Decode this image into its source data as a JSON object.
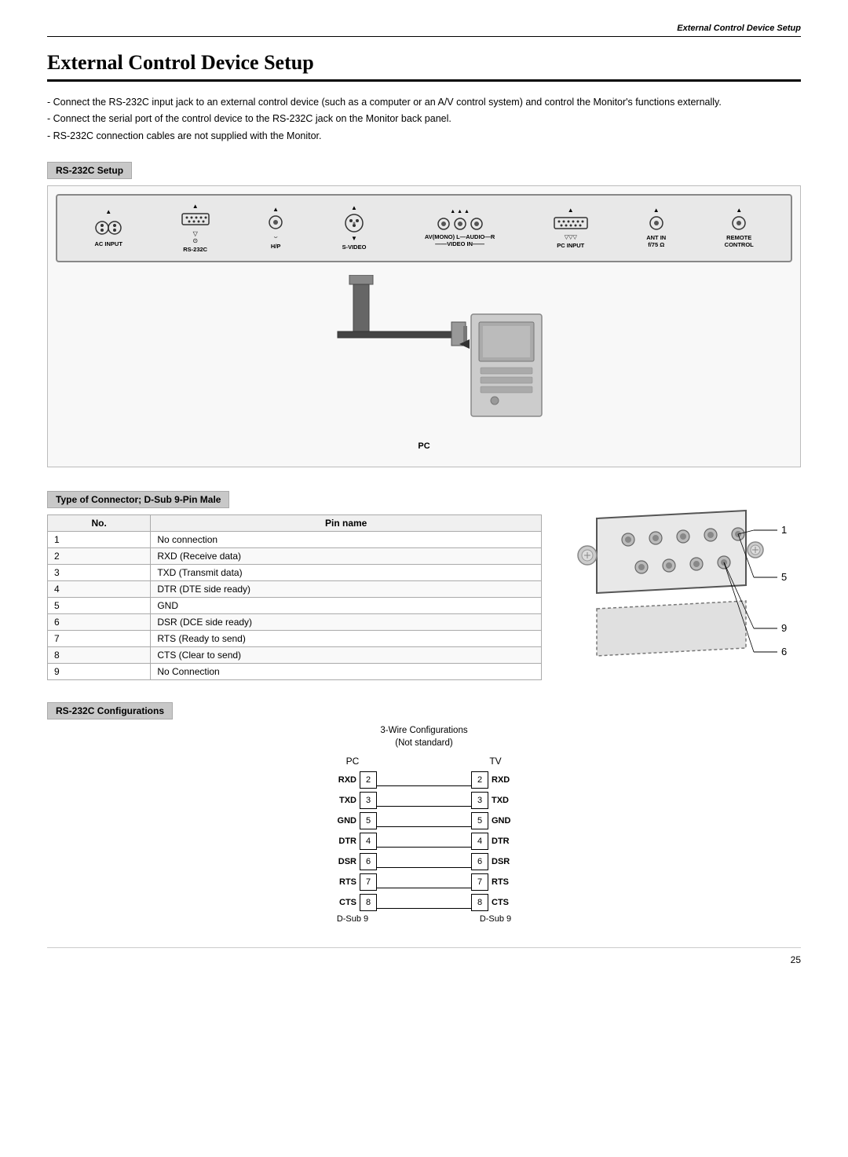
{
  "header": {
    "title": "External Control Device Setup"
  },
  "page_title": "External Control Device Setup",
  "intro": {
    "items": [
      "Connect the RS-232C input jack to an external control device (such as a computer or an A/V control system) and control the Monitor's functions externally.",
      "Connect the serial port of the control device to the RS-232C jack on the Monitor back panel.",
      "RS-232C connection cables are not supplied with the Monitor."
    ]
  },
  "rs232c_setup": {
    "label": "RS-232C Setup",
    "pc_label": "PC",
    "back_panel": {
      "items": [
        {
          "icon": "⊕",
          "label": "AC INPUT"
        },
        {
          "icon": "▭",
          "label": "RS-232C"
        },
        {
          "icon": "●",
          "label": "H/P"
        },
        {
          "icon": "⊕",
          "label": "S-VIDEO"
        },
        {
          "icon": "⊕⊕⊕",
          "label": "AV(MONO)  AUDIO  R\n—VIDEO IN—"
        },
        {
          "icon": "▭▭",
          "label": "PC INPUT"
        },
        {
          "icon": "●",
          "label": "ANT IN\nf/75 Ω"
        },
        {
          "icon": "●",
          "label": "REMOTE\nCONTROL"
        }
      ]
    }
  },
  "connector": {
    "section_label": "Type of Connector; D-Sub 9-Pin Male",
    "table": {
      "headers": [
        "No.",
        "Pin name"
      ],
      "rows": [
        [
          "1",
          "No connection"
        ],
        [
          "2",
          "RXD (Receive data)"
        ],
        [
          "3",
          "TXD (Transmit data)"
        ],
        [
          "4",
          "DTR (DTE side ready)"
        ],
        [
          "5",
          "GND"
        ],
        [
          "6",
          "DSR (DCE side ready)"
        ],
        [
          "7",
          "RTS (Ready to send)"
        ],
        [
          "8",
          "CTS (Clear to send)"
        ],
        [
          "9",
          "No Connection"
        ]
      ]
    },
    "diagram_numbers": {
      "top_right": "1",
      "mid_right": "5",
      "bottom_right_1": "9",
      "bottom_right_2": "6"
    }
  },
  "configurations": {
    "section_label": "RS-232C Configurations",
    "sub_label": "3-Wire Configurations",
    "sub_label2": "(Not standard)",
    "left_header": "PC",
    "right_header": "TV",
    "left_footer": "D-Sub 9",
    "right_footer": "D-Sub 9",
    "wires": [
      {
        "left_label": "RXD",
        "left_num": "2",
        "right_num": "2",
        "right_label": "RXD"
      },
      {
        "left_label": "TXD",
        "left_num": "3",
        "right_num": "3",
        "right_label": "TXD"
      },
      {
        "left_label": "GND",
        "left_num": "5",
        "right_num": "5",
        "right_label": "GND"
      },
      {
        "left_label": "DTR",
        "left_num": "4",
        "right_num": "4",
        "right_label": "DTR"
      },
      {
        "left_label": "DSR",
        "left_num": "6",
        "right_num": "6",
        "right_label": "DSR"
      },
      {
        "left_label": "RTS",
        "left_num": "7",
        "right_num": "7",
        "right_label": "RTS"
      },
      {
        "left_label": "CTS",
        "left_num": "8",
        "right_num": "8",
        "right_label": "CTS"
      }
    ]
  },
  "page_number": "25"
}
